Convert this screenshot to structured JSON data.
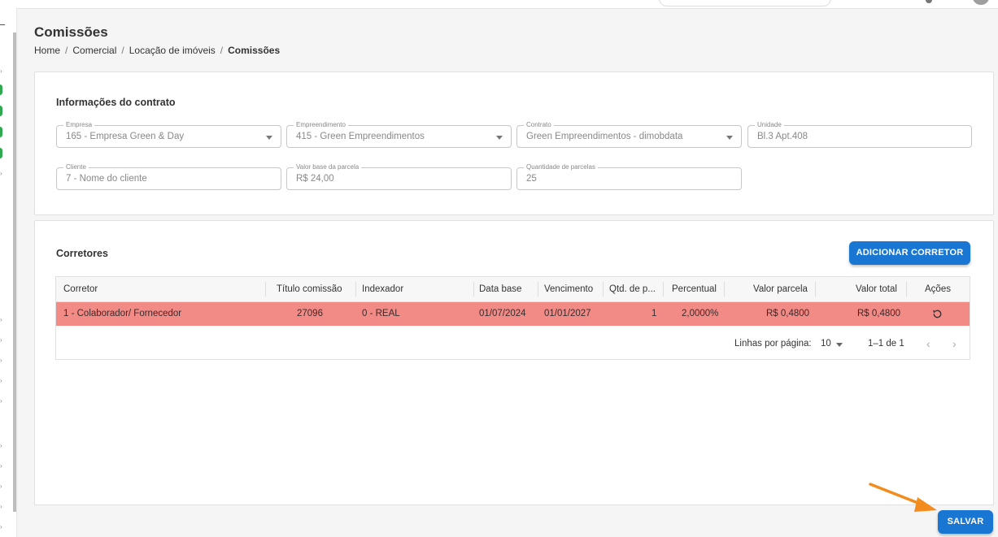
{
  "page": {
    "title": "Comissões",
    "breadcrumb": [
      "Home",
      "Comercial",
      "Locação de imóveis",
      "Comissões"
    ]
  },
  "contract": {
    "section_title": "Informações do contrato",
    "fields": [
      {
        "label": "Empresa",
        "value": "165 - Empresa Green & Day",
        "type": "select"
      },
      {
        "label": "Empreendimento",
        "value": "415 - Green Empreendimentos",
        "type": "select"
      },
      {
        "label": "Contrato",
        "value": "Green Empreendimentos - dimobdata",
        "type": "select"
      },
      {
        "label": "Unidade",
        "value": "Bl.3 Apt.408",
        "type": "text"
      },
      {
        "label": "Cliente",
        "value": "7 - Nome do cliente",
        "type": "text"
      },
      {
        "label": "Valor base da parcela",
        "value": "R$ 24,00",
        "type": "text"
      },
      {
        "label": "Quantidade de parcelas",
        "value": "25",
        "type": "text"
      }
    ]
  },
  "brokers": {
    "section_title": "Corretores",
    "add_button": "ADICIONAR CORRETOR",
    "columns": [
      "Corretor",
      "Título comissão",
      "Indexador",
      "Data base",
      "Vencimento",
      "Qtd. de p...",
      "Percentual",
      "Valor parcela",
      "Valor total",
      "Ações"
    ],
    "rows": [
      {
        "corretor": "1 - Colaborador/ Fornecedor",
        "titulo": "27096",
        "indexador": "0 - REAL",
        "data_base": "01/07/2024",
        "vencimento": "01/01/2027",
        "qtd": "1",
        "percentual": "2,0000%",
        "valor_parcela": "R$ 0,4800",
        "valor_total": "R$ 0,4800",
        "action_icon": "refresh-icon",
        "row_color": "#f28a86"
      }
    ],
    "pagination": {
      "rows_per_page_label": "Linhas por página:",
      "rows_per_page": "10",
      "range": "1–1 de 1"
    }
  },
  "save_button": "SALVAR",
  "colors": {
    "primary": "#1976d2",
    "annotation_arrow": "#f28c1e",
    "highlight_row": "#f28a86"
  }
}
